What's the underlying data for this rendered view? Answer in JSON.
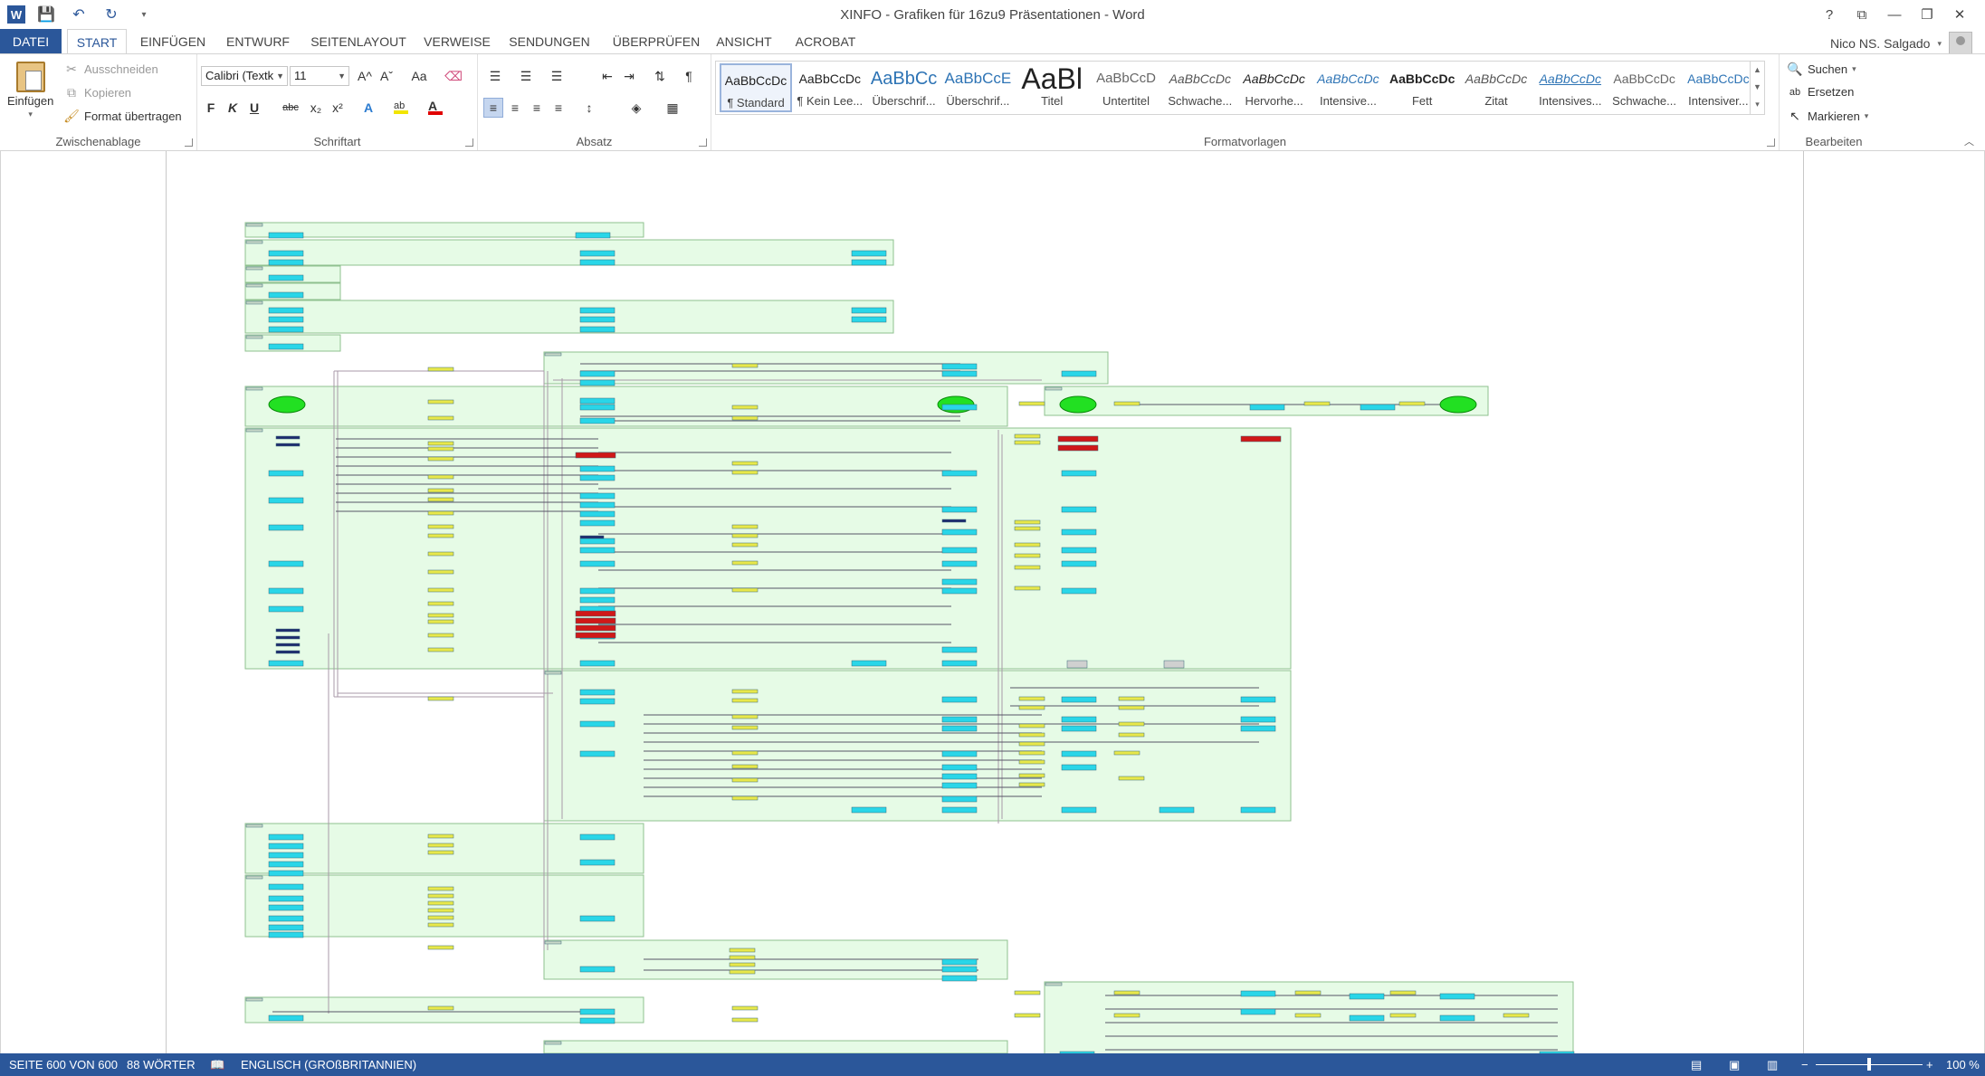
{
  "window": {
    "title": "XINFO - Grafiken für 16zu9 Präsentationen - Word",
    "controls": [
      "?",
      "⧉",
      "—",
      "❐",
      "✕"
    ]
  },
  "qat": [
    "W",
    "💾",
    "↶",
    "↻",
    "▾"
  ],
  "tabs": [
    "DATEI",
    "START",
    "EINFÜGEN",
    "ENTWURF",
    "SEITENLAYOUT",
    "VERWEISE",
    "SENDUNGEN",
    "ÜBERPRÜFEN",
    "ANSICHT",
    "ACROBAT"
  ],
  "user": {
    "name": "Nico NS. Salgado"
  },
  "clipboard": {
    "paste": "Einfügen",
    "cut": "Ausschneiden",
    "copy": "Kopieren",
    "format_painter": "Format übertragen",
    "label": "Zwischenablage"
  },
  "font": {
    "family": "Calibri (Textk",
    "size": "11",
    "grow": "A^",
    "shrink": "Aˇ",
    "case": "Aa",
    "bold": "F",
    "italic": "K",
    "underline": "U",
    "strike": "abc",
    "subscript": "x₂",
    "superscript": "x²",
    "label": "Schriftart"
  },
  "paragraph": {
    "label": "Absatz"
  },
  "styles": {
    "label": "Formatvorlagen",
    "items": [
      {
        "sample": "AaBbCcDc",
        "name": "¶ Standard"
      },
      {
        "sample": "AaBbCcDc",
        "name": "¶ Kein Lee..."
      },
      {
        "sample": "AaBbCc",
        "name": "Überschrif..."
      },
      {
        "sample": "AaBbCcE",
        "name": "Überschrif..."
      },
      {
        "sample": "AaBl",
        "name": "Titel"
      },
      {
        "sample": "AaBbCcD",
        "name": "Untertitel"
      },
      {
        "sample": "AaBbCcDc",
        "name": "Schwache..."
      },
      {
        "sample": "AaBbCcDc",
        "name": "Hervorhe..."
      },
      {
        "sample": "AaBbCcDc",
        "name": "Intensive..."
      },
      {
        "sample": "AaBbCcDc",
        "name": "Fett"
      },
      {
        "sample": "AaBbCcDc",
        "name": "Zitat"
      },
      {
        "sample": "AaBbCcDc",
        "name": "Intensives..."
      },
      {
        "sample": "AaBbCcDc",
        "name": "Schwache..."
      },
      {
        "sample": "AaBbCcDc",
        "name": "Intensiver..."
      }
    ]
  },
  "editing": {
    "find": "Suchen",
    "replace": "Ersetzen",
    "select": "Markieren",
    "label": "Bearbeiten"
  },
  "status": {
    "page": "SEITE 600 VON 600",
    "words": "88 WÖRTER",
    "language": "ENGLISCH (GROßBRITANNIEN)",
    "zoom": "100 %",
    "zoom_level": 1.0
  },
  "colors": {
    "accent": "#2b579a",
    "panel_fill": "#e6fbe6",
    "panel_border": "#8fc08f",
    "node_cyan": "#29d6e8",
    "node_yellow": "#e8e84a",
    "node_red": "#d01818",
    "node_navy": "#1e2a6e",
    "node_green": "#22e022"
  }
}
